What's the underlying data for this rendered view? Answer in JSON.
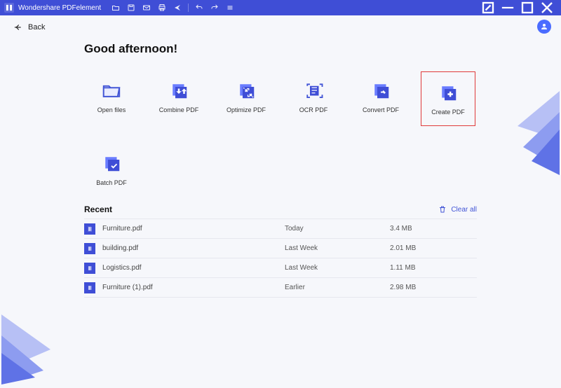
{
  "app": {
    "title": "Wondershare PDFelement"
  },
  "nav": {
    "back_label": "Back"
  },
  "main": {
    "greeting": "Good afternoon!",
    "tiles": [
      {
        "label": "Open files"
      },
      {
        "label": "Combine PDF"
      },
      {
        "label": "Optimize PDF"
      },
      {
        "label": "OCR PDF"
      },
      {
        "label": "Convert PDF"
      },
      {
        "label": "Create PDF"
      },
      {
        "label": "Batch PDF"
      }
    ]
  },
  "recent": {
    "heading": "Recent",
    "clear_label": "Clear all",
    "items": [
      {
        "name": "Furniture.pdf",
        "time": "Today",
        "size": "3.4 MB"
      },
      {
        "name": "building.pdf",
        "time": "Last Week",
        "size": "2.01 MB"
      },
      {
        "name": "Logistics.pdf",
        "time": "Last Week",
        "size": "1.11 MB"
      },
      {
        "name": "Furniture (1).pdf",
        "time": "Earlier",
        "size": "2.98 MB"
      }
    ]
  },
  "colors": {
    "brand": "#3f4ed6",
    "accent_dark": "#2a36b8",
    "highlight": "#e03a3a",
    "pale": "#c8cef7"
  }
}
